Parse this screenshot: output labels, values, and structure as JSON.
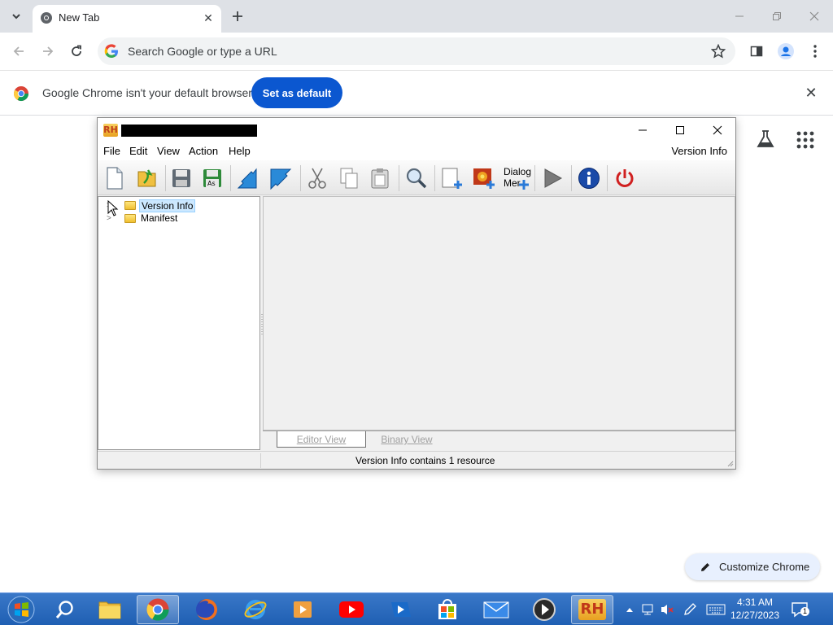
{
  "browser": {
    "tab_title": "New Tab",
    "omnibox_placeholder": "Search Google or type a URL",
    "infobar_text": "Google Chrome isn't your default browser",
    "set_default_label": "Set as default",
    "customize_label": "Customize Chrome"
  },
  "rh_window": {
    "menu": [
      "File",
      "Edit",
      "View",
      "Action",
      "Help"
    ],
    "menu_right": "Version Info",
    "toolbar_dialog_label": "Dialog",
    "toolbar_dialog_label2": "Mer",
    "tree": [
      {
        "label": "Version Info",
        "selected": true
      },
      {
        "label": "Manifest",
        "selected": false
      }
    ],
    "tabs": [
      "Editor View",
      "Binary View"
    ],
    "status": "Version Info contains 1 resource"
  },
  "taskbar": {
    "time": "4:31 AM",
    "date": "12/27/2023",
    "notification_count": "1"
  }
}
